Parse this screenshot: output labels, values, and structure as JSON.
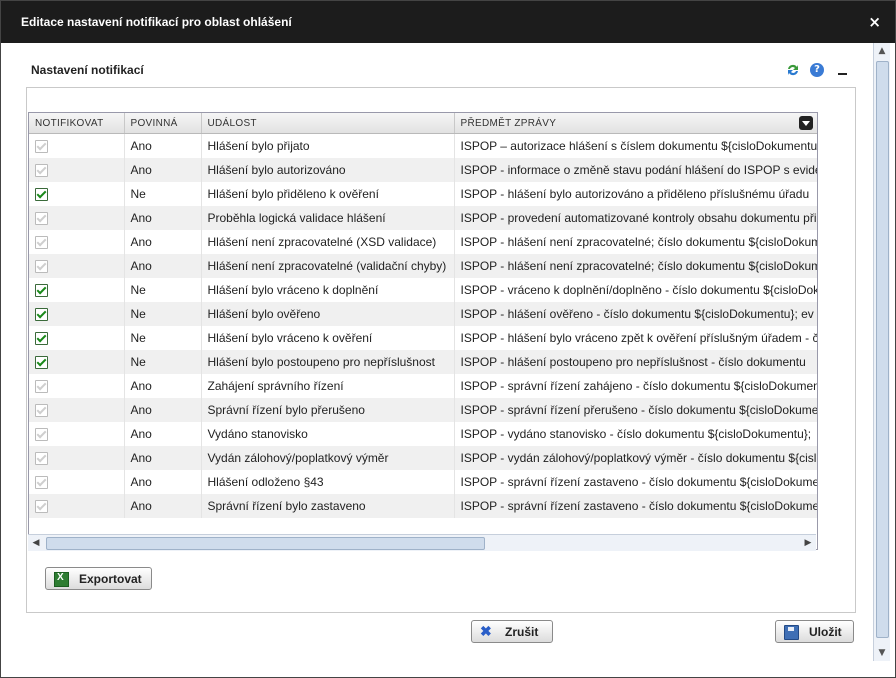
{
  "dialog": {
    "title": "Editace nastavení notifikací pro oblast ohlášení",
    "close_symbol": "×"
  },
  "section": {
    "title": "Nastavení notifikací",
    "icons": [
      "refresh-icon",
      "help-icon",
      "minimize-icon"
    ]
  },
  "table": {
    "columns": [
      "NOTIFIKOVAT",
      "POVINNÁ",
      "UDÁLOST",
      "PŘEDMĚT ZPRÁVY"
    ],
    "rows": [
      {
        "notify": true,
        "enabled": false,
        "required": "Ano",
        "event": "Hlášení bylo přijato",
        "subject": "ISPOP – autorizace hlášení s číslem dokumentu ${cisloDokumentu}"
      },
      {
        "notify": true,
        "enabled": false,
        "required": "Ano",
        "event": "Hlášení bylo autorizováno",
        "subject": "ISPOP - informace o změně stavu podání hlášení do ISPOP s evidenčním"
      },
      {
        "notify": true,
        "enabled": true,
        "required": "Ne",
        "event": "Hlášení bylo přiděleno k ověření",
        "subject": "ISPOP - hlášení bylo autorizováno a přiděleno příslušnému úřadu"
      },
      {
        "notify": true,
        "enabled": false,
        "required": "Ano",
        "event": "Proběhla logická validace hlášení",
        "subject": "ISPOP - provedení automatizované kontroly obsahu dokumentu při"
      },
      {
        "notify": true,
        "enabled": false,
        "required": "Ano",
        "event": "Hlášení není zpracovatelné (XSD validace)",
        "subject": "ISPOP - hlášení není zpracovatelné; číslo dokumentu ${cisloDokumentu}"
      },
      {
        "notify": true,
        "enabled": false,
        "required": "Ano",
        "event": "Hlášení není zpracovatelné (validační chyby)",
        "subject": "ISPOP - hlášení není zpracovatelné; číslo dokumentu ${cisloDokumentu}"
      },
      {
        "notify": true,
        "enabled": true,
        "required": "Ne",
        "event": "Hlášení bylo vráceno k doplnění",
        "subject": "ISPOP - vráceno k doplnění/doplněno - číslo dokumentu ${cisloDokumentu}"
      },
      {
        "notify": true,
        "enabled": true,
        "required": "Ne",
        "event": "Hlášení bylo ověřeno",
        "subject": "ISPOP - hlášení ověřeno - číslo dokumentu ${cisloDokumentu}; ev"
      },
      {
        "notify": true,
        "enabled": true,
        "required": "Ne",
        "event": "Hlášení bylo vráceno k ověření",
        "subject": "ISPOP - hlášení bylo vráceno zpět k ověření příslušným úřadem - č"
      },
      {
        "notify": true,
        "enabled": true,
        "required": "Ne",
        "event": "Hlášení bylo postoupeno pro nepříslušnost",
        "subject": "ISPOP - hlášení postoupeno pro nepříslušnost - číslo dokumentu"
      },
      {
        "notify": true,
        "enabled": false,
        "required": "Ano",
        "event": "Zahájení správního řízení",
        "subject": "ISPOP - správní řízení zahájeno - číslo dokumentu ${cisloDokumentu}"
      },
      {
        "notify": true,
        "enabled": false,
        "required": "Ano",
        "event": "Správní řízení bylo přerušeno",
        "subject": "ISPOP - správní řízení přerušeno - číslo dokumentu ${cisloDokumentu}"
      },
      {
        "notify": true,
        "enabled": false,
        "required": "Ano",
        "event": "Vydáno stanovisko",
        "subject": "ISPOP - vydáno stanovisko - číslo dokumentu ${cisloDokumentu};"
      },
      {
        "notify": true,
        "enabled": false,
        "required": "Ano",
        "event": "Vydán zálohový/poplatkový výměr",
        "subject": "ISPOP - vydán zálohový/poplatkový výměr - číslo dokumentu ${cisloDokumentu}"
      },
      {
        "notify": true,
        "enabled": false,
        "required": "Ano",
        "event": "Hlášení odloženo §43",
        "subject": "ISPOP - správní řízení zastaveno - číslo dokumentu ${cisloDokumentu}"
      },
      {
        "notify": true,
        "enabled": false,
        "required": "Ano",
        "event": "Správní řízení bylo zastaveno",
        "subject": "ISPOP - správní řízení zastaveno - číslo dokumentu ${cisloDokumentu}"
      }
    ]
  },
  "buttons": {
    "export": "Exportovat",
    "cancel": "Zrušit",
    "save": "Uložit"
  },
  "colors": {
    "titlebar": "#1c1c1c",
    "check": "#1a8a1a"
  }
}
